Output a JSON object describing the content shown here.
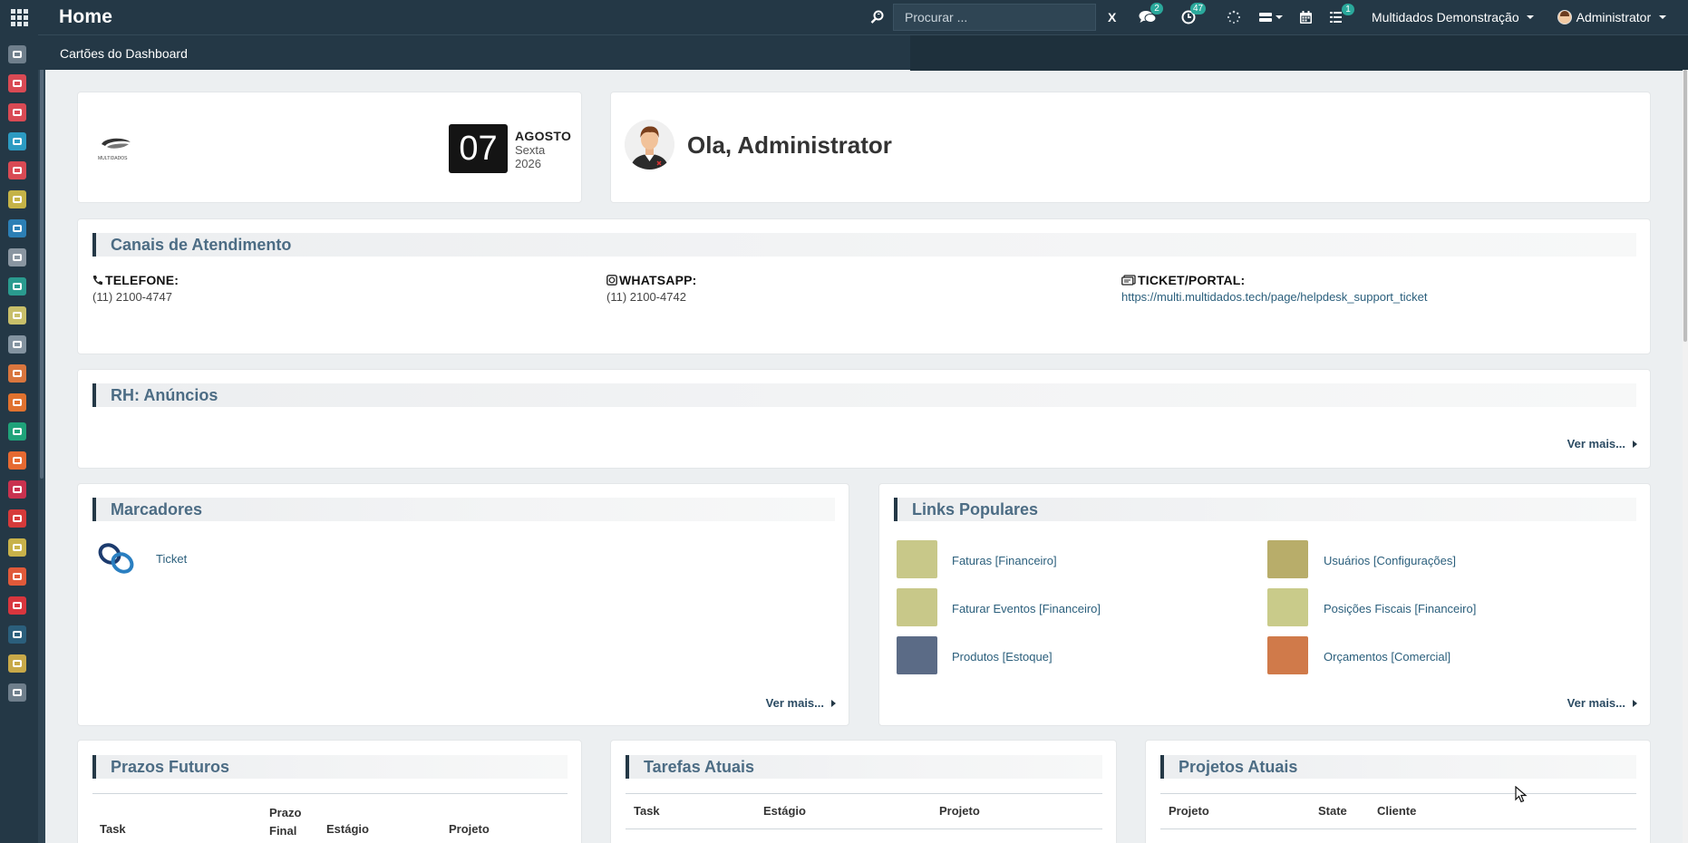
{
  "topbar": {
    "title": "Home",
    "search_placeholder": "Procurar ...",
    "search_clear": "X",
    "messages_badge": "2",
    "activities_badge": "47",
    "tasks_badge": "1",
    "company": "Multidados Demonstração",
    "user": "Administrator"
  },
  "breadcrumb": "Cartões do Dashboard",
  "date_card": {
    "day": "07",
    "month": "AGOSTO",
    "weekday": "Sexta",
    "year": "2026",
    "logo_text": "MULTIDADOS"
  },
  "greeting": "Ola, Administrator",
  "canais": {
    "title": "Canais de Atendimento",
    "items": [
      {
        "label": "TELEFONE:",
        "value": "(11) 2100-4747",
        "icon": "phone-icon"
      },
      {
        "label": "WHATSAPP:",
        "value": "(11) 2100-4742",
        "icon": "whatsapp-icon"
      },
      {
        "label": "TICKET/PORTAL:",
        "value": "https://multi.multidados.tech/page/helpdesk_support_ticket",
        "icon": "ticket-icon"
      }
    ]
  },
  "rh": {
    "title": "RH: Anúncios",
    "more": "Ver mais..."
  },
  "marcadores": {
    "title": "Marcadores",
    "items": [
      {
        "label": "Ticket",
        "icon": "link-icon"
      }
    ],
    "more": "Ver mais..."
  },
  "links": {
    "title": "Links Populares",
    "items": [
      {
        "label": "Faturas [Financeiro]",
        "color": "#c8c889"
      },
      {
        "label": "Usuários [Configurações]",
        "color": "#b8ad6a"
      },
      {
        "label": "Faturar Eventos [Financeiro]",
        "color": "#c8c889"
      },
      {
        "label": "Posições Fiscais [Financeiro]",
        "color": "#c9cb8a"
      },
      {
        "label": "Produtos [Estoque]",
        "color": "#5b6b86"
      },
      {
        "label": "Orçamentos [Comercial]",
        "color": "#d07a4a"
      }
    ],
    "more": "Ver mais..."
  },
  "prazos": {
    "title": "Prazos Futuros",
    "columns": [
      "Task",
      "Prazo Final",
      "Estágio",
      "Projeto"
    ]
  },
  "tarefas": {
    "title": "Tarefas Atuais",
    "columns": [
      "Task",
      "Estágio",
      "Projeto"
    ]
  },
  "projetos": {
    "title": "Projetos Atuais",
    "columns": [
      "Projeto",
      "State",
      "Cliente"
    ]
  },
  "sidebar_apps": [
    {
      "name": "home-app-icon",
      "color": "#6f7f8c"
    },
    {
      "name": "discuss-app-icon",
      "color": "#d94a54"
    },
    {
      "name": "helpdesk-app-icon",
      "color": "#d94a54"
    },
    {
      "name": "settings-app-icon",
      "color": "#2c9bc2"
    },
    {
      "name": "sales-app-icon",
      "color": "#d94a54"
    },
    {
      "name": "notes-app-icon",
      "color": "#c5b347"
    },
    {
      "name": "invoicing-app-icon",
      "color": "#2c7fb5"
    },
    {
      "name": "dms-app-icon",
      "color": "#8a96a1"
    },
    {
      "name": "contacts-app-icon",
      "color": "#2a9b8f"
    },
    {
      "name": "project-app-icon",
      "color": "#c8bf6a"
    },
    {
      "name": "crm-app-icon",
      "color": "#8393a0"
    },
    {
      "name": "documents-app-icon",
      "color": "#d9763e"
    },
    {
      "name": "website-app-icon",
      "color": "#e0722f"
    },
    {
      "name": "whatsapp-app-icon",
      "color": "#1fa37a"
    },
    {
      "name": "survey-app-icon",
      "color": "#e66a32"
    },
    {
      "name": "maintenance-app-icon",
      "color": "#c9324f"
    },
    {
      "name": "list-app-icon",
      "color": "#d63a3a"
    },
    {
      "name": "calendar-app-icon",
      "color": "#c8b24a"
    },
    {
      "name": "mail-app-icon",
      "color": "#e05a3a"
    },
    {
      "name": "folder-app-icon",
      "color": "#d9363e"
    },
    {
      "name": "camera-app-icon",
      "color": "#2b5f7c"
    },
    {
      "name": "purchase-app-icon",
      "color": "#c8a949"
    },
    {
      "name": "printer-app-icon",
      "color": "#6f7f8c"
    }
  ]
}
